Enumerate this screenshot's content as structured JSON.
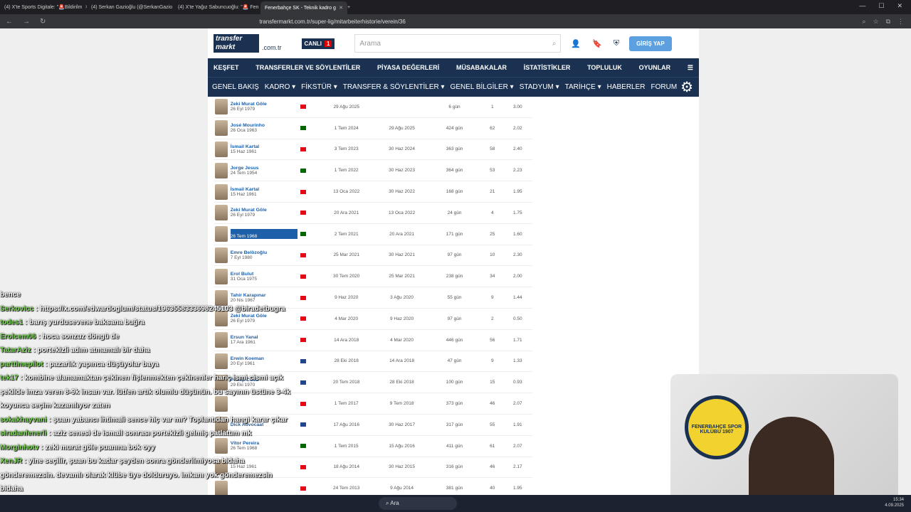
{
  "tabs": [
    {
      "label": "(4) X'te Sports Digitale: \"🚨Bildirilm"
    },
    {
      "label": "(4) Serkan Gazioğlu (@SerkanGazio"
    },
    {
      "label": "(4) X'te Yağız Sabuncuoğlu: \"🚨 Fen"
    },
    {
      "label": "Fenerbahçe SK - Teknik kadro g"
    }
  ],
  "url": "transfermarkt.com.tr/super-lig/mitarbeiterhistorie/verein/36",
  "site": {
    "logo": "transfer markt",
    "domain": ".com.tr",
    "live": "CANLI",
    "live_count": "1",
    "search_placeholder": "Arama",
    "login": "GİRİŞ YAP"
  },
  "menu1": [
    "KEŞFET",
    "TRANSFERLER VE SÖYLENTİLER",
    "PİYASA DEĞERLERİ",
    "MÜSABAKALAR",
    "İSTATİSTİKLER",
    "TOPLULUK",
    "OYUNLAR"
  ],
  "menu2": [
    "GENEL BAKIŞ",
    "KADRO ▾",
    "FİKSTÜR ▾",
    "TRANSFER & SÖYLENTİLER ▾",
    "GENEL BİLGİLER ▾",
    "STADYUM ▾",
    "TARİHÇE ▾",
    "HABERLER",
    "FORUM"
  ],
  "coaches": [
    {
      "name": "Zeki Murat Göle",
      "dob": "26 Eyl 1979",
      "flag": "#e30a17",
      "from": "29 Ağu 2025",
      "to": "",
      "days": "6 gün",
      "games": "1",
      "ppm": "3.00"
    },
    {
      "name": "José Mourinho",
      "dob": "26 Oca 1963",
      "flag": "#006600",
      "from": "1 Tem 2024",
      "to": "29 Ağu 2025",
      "days": "424 gün",
      "games": "62",
      "ppm": "2.02"
    },
    {
      "name": "İsmail Kartal",
      "dob": "15 Haz 1961",
      "flag": "#e30a17",
      "from": "3 Tem 2023",
      "to": "30 Haz 2024",
      "days": "363 gün",
      "games": "58",
      "ppm": "2.40"
    },
    {
      "name": "Jorge Jesus",
      "dob": "24 Tem 1954",
      "flag": "#006600",
      "from": "1 Tem 2022",
      "to": "30 Haz 2023",
      "days": "364 gün",
      "games": "53",
      "ppm": "2.23"
    },
    {
      "name": "İsmail Kartal",
      "dob": "15 Haz 1961",
      "flag": "#e30a17",
      "from": "13 Oca 2022",
      "to": "30 Haz 2022",
      "days": "168 gün",
      "games": "21",
      "ppm": "1.95"
    },
    {
      "name": "Zeki Murat Göle",
      "dob": "26 Eyl 1979",
      "flag": "#e30a17",
      "from": "20 Ara 2021",
      "to": "13 Oca 2022",
      "days": "24 gün",
      "games": "4",
      "ppm": "1.75"
    },
    {
      "name": "Vítor Pereira",
      "dob": "26 Tem 1968",
      "flag": "#006600",
      "from": "2 Tem 2021",
      "to": "20 Ara 2021",
      "days": "171 gün",
      "games": "25",
      "ppm": "1.60",
      "selected": true
    },
    {
      "name": "Emre Belözoğlu",
      "dob": "7 Eyl 1980",
      "flag": "#e30a17",
      "from": "25 Mar 2021",
      "to": "30 Haz 2021",
      "days": "97 gün",
      "games": "10",
      "ppm": "2.30"
    },
    {
      "name": "Erol Bulut",
      "dob": "31 Oca 1975",
      "flag": "#e30a17",
      "from": "30 Tem 2020",
      "to": "25 Mar 2021",
      "days": "238 gün",
      "games": "34",
      "ppm": "2.00"
    },
    {
      "name": "Tahir Karapınar",
      "dob": "20 Nis 1967",
      "flag": "#e30a17",
      "from": "9 Haz 2020",
      "to": "3 Ağu 2020",
      "days": "55 gün",
      "games": "9",
      "ppm": "1.44"
    },
    {
      "name": "Zeki Murat Göle",
      "dob": "26 Eyl 1979",
      "flag": "#e30a17",
      "from": "4 Mar 2020",
      "to": "9 Haz 2020",
      "days": "97 gün",
      "games": "2",
      "ppm": "0.50"
    },
    {
      "name": "Ersun Yanal",
      "dob": "17 Ara 1961",
      "flag": "#e30a17",
      "from": "14 Ara 2018",
      "to": "4 Mar 2020",
      "days": "446 gün",
      "games": "56",
      "ppm": "1.71"
    },
    {
      "name": "Erwin Koeman",
      "dob": "20 Eyl 1961",
      "flag": "#21468b",
      "from": "28 Eki 2018",
      "to": "14 Ara 2018",
      "days": "47 gün",
      "games": "9",
      "ppm": "1.33"
    },
    {
      "name": "Phillip Cocu",
      "dob": "29 Eki 1970",
      "flag": "#21468b",
      "from": "20 Tem 2018",
      "to": "28 Eki 2018",
      "days": "100 gün",
      "games": "15",
      "ppm": "0.93"
    },
    {
      "name": "",
      "dob": "",
      "flag": "#e30a17",
      "from": "1 Tem 2017",
      "to": "9 Tem 2018",
      "days": "373 gün",
      "games": "46",
      "ppm": "2.07"
    },
    {
      "name": "Dick Advocaat",
      "dob": "",
      "flag": "#21468b",
      "from": "17 Ağu 2016",
      "to": "30 Haz 2017",
      "days": "317 gün",
      "games": "55",
      "ppm": "1.91"
    },
    {
      "name": "Vítor Pereira",
      "dob": "26 Tem 1968",
      "flag": "#006600",
      "from": "1 Tem 2015",
      "to": "15 Ağu 2016",
      "days": "411 gün",
      "games": "61",
      "ppm": "2.07"
    },
    {
      "name": "",
      "dob": "15 Haz 1961",
      "flag": "#e30a17",
      "from": "18 Ağu 2014",
      "to": "30 Haz 2015",
      "days": "316 gün",
      "games": "46",
      "ppm": "2.17"
    },
    {
      "name": "",
      "dob": "",
      "flag": "#e30a17",
      "from": "24 Tem 2013",
      "to": "9 Ağu 2014",
      "days": "381 gün",
      "games": "40",
      "ppm": "1.95"
    }
  ],
  "chat": [
    {
      "user": "",
      "msg": "bence"
    },
    {
      "user": "Serkovicc",
      "msg": ": https://x.com/edwardoglum/status/1963558333698245103 @biradetbugra"
    },
    {
      "user": "todes1",
      "msg": ": barış yurdusevene baksana buğra"
    },
    {
      "user": "Erolcem06",
      "msg": ": hoca sonzuz döngü de"
    },
    {
      "user": "TatarAziz",
      "msg": ": portekizli adım atmamalı bir daha"
    },
    {
      "user": "parttimepilot",
      "msg": ": pazarlık yapınca düşüyolar baya"
    },
    {
      "user": "tek17",
      "msg": ": kombine alamamaktan çekinen fişlenmekten çekinenler hariç ismi cismi açık şekilde imza veren 8-9k insan var. lütfen artık olumlu düşünün. bu sayının üstüne 3-4k koyunca seçim kazanılıyor zaten"
    },
    {
      "user": "sokakhayvani",
      "msg": ": şuan yabancı ihtimali sence hiç var mı? Toplantıdan hangi karar çıkar"
    },
    {
      "user": "siradanfenerli",
      "msg": ": aziz senesi de ismail sonrası portekizli gelmiş patlattım mk"
    },
    {
      "user": "Morginhotv",
      "msg": ": zeki murat göle puanına bok oyy"
    },
    {
      "user": "XenJR",
      "msg": ": yine seçilir, şuan bu kadar şeyden sonra gönderilmiyosa bidaha gönderemezsin. devamlı olarak klübe üye dolduruyo. imkanı yok gönderemezsin bidaha"
    }
  ],
  "cam": {
    "emblem": "FENERBAHÇE SPOR KULÜBÜ 1907",
    "badge": "FENERBAHÇE"
  },
  "taskbar": {
    "search": "Ara",
    "time": "15:34",
    "date": "4.09.2025"
  }
}
